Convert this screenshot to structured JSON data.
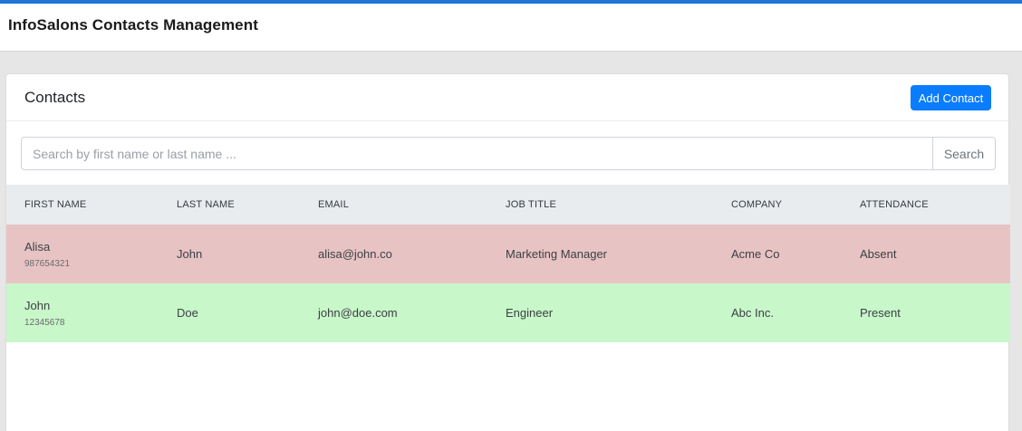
{
  "header": {
    "title": "InfoSalons Contacts Management"
  },
  "card": {
    "title": "Contacts",
    "add_label": "Add Contact"
  },
  "search": {
    "placeholder": "Search by first name or last name ...",
    "value": "",
    "button_label": "Search"
  },
  "table": {
    "columns": [
      "FIRST NAME",
      "LAST NAME",
      "EMAIL",
      "JOB TITLE",
      "COMPANY",
      "ATTENDANCE"
    ],
    "rows": [
      {
        "first_name": "Alisa",
        "phone": "987654321",
        "last_name": "John",
        "email": "alisa@john.co",
        "job_title": "Marketing Manager",
        "company": "Acme Co",
        "attendance": "Absent"
      },
      {
        "first_name": "John",
        "phone": "12345678",
        "last_name": "Doe",
        "email": "john@doe.com",
        "job_title": "Engineer",
        "company": "Abc Inc.",
        "attendance": "Present"
      }
    ]
  },
  "colors": {
    "accent": "#1f74d6",
    "button": "#0a7cff",
    "absent_row": "#e8c3c4",
    "present_row": "#c8f7ca",
    "table_header": "#e9ecef"
  }
}
